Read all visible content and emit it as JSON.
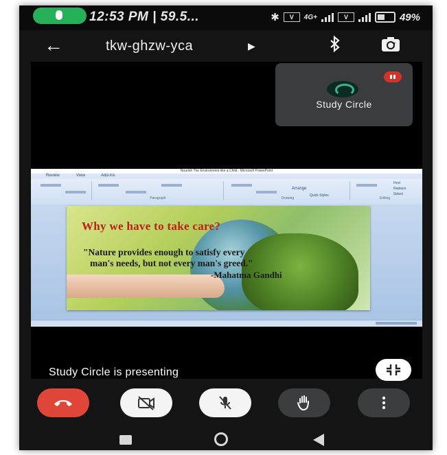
{
  "status_bar": {
    "time": "12:53 PM | 59.5...",
    "network_1": "4G+",
    "battery": "49%"
  },
  "header": {
    "meeting_code": "tkw-ghzw-yca"
  },
  "self_tile": {
    "name": "Study Circle"
  },
  "shared_screen": {
    "window_title": "Nourish The Environment like a Child - Microsoft PowerPoint",
    "ribbon_tabs": [
      "Review",
      "View",
      "Add-Ins"
    ],
    "ribbon_groups": [
      "Paragraph",
      "Drawing",
      "Editing"
    ],
    "ribbon_buttons": [
      "Arrange",
      "Quick Styles",
      "Find",
      "Replace",
      "Select"
    ],
    "slide": {
      "heading": "Why we have to take care?",
      "quote_line1": "\"Nature provides enough to satisfy every",
      "quote_line2": "man's needs, but not every man's greed.\"",
      "author": "-Mahatma Gandhi"
    }
  },
  "presenting_text": "Study Circle is presenting",
  "colors": {
    "end_call": "#e0453a",
    "mute_badge": "#d2332b",
    "mic_pill": "#27b05a"
  },
  "icons": {
    "back": "arrow-left-icon",
    "title_arrow": "triangle-right-icon",
    "bluetooth": "bluetooth-icon",
    "switch_camera": "switch-camera-icon",
    "exit_fullscreen": "exit-fullscreen-icon",
    "end_call": "phone-hangup-icon",
    "camera": "camera-off-icon",
    "microphone": "mic-off-icon",
    "raise_hand": "hand-icon",
    "more": "more-vertical-icon"
  }
}
